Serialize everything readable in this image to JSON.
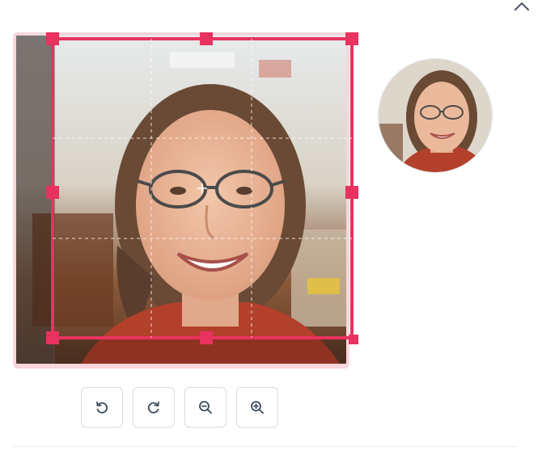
{
  "icons": {
    "collapse": "chevron-up-icon",
    "rotate_left": "rotate-ccw-icon",
    "rotate_right": "rotate-cw-icon",
    "zoom_out": "zoom-out-icon",
    "zoom_in": "zoom-in-icon"
  },
  "colors": {
    "crop_accent": "#e8325f",
    "button_border": "#d6dbe4",
    "icon_stroke": "#3c4a5d"
  }
}
